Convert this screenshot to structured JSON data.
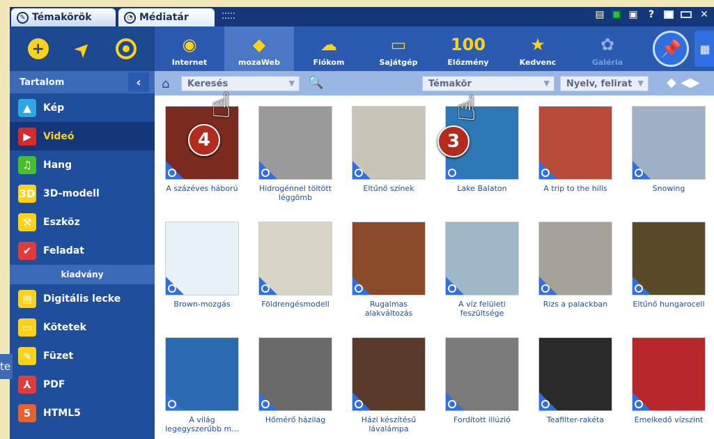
{
  "tabs": [
    {
      "label": "Témakörök",
      "icon": "topics-icon"
    },
    {
      "label": "Médiatár",
      "icon": "media-icon"
    }
  ],
  "window_controls": [
    "view-list-icon",
    "green-status-icon",
    "view-box-icon",
    "help-icon",
    "restore-icon",
    "minimize-icon",
    "close-icon"
  ],
  "help_glyph": "?",
  "close_glyph": "✕",
  "toolbar": [
    {
      "label": "Internet",
      "icon": "internet-icon"
    },
    {
      "label": "mozaWeb",
      "icon": "mozaweb-icon"
    },
    {
      "label": "Fiókom",
      "icon": "account-icon"
    },
    {
      "label": "Sajátgép",
      "icon": "computer-icon"
    },
    {
      "label": "Előzmény",
      "icon": "history-icon",
      "glyph": "100"
    },
    {
      "label": "Kedvenc",
      "icon": "favorite-icon"
    },
    {
      "label": "Galéria",
      "icon": "gallery-icon"
    }
  ],
  "sidebar": {
    "header": "Tartalom",
    "items": [
      {
        "label": "Kép",
        "icon": "image-icon",
        "glyph": "▲",
        "color": "#2fa8e0"
      },
      {
        "label": "Videó",
        "icon": "video-icon",
        "glyph": "▶",
        "color": "#d42a2a",
        "active": true
      },
      {
        "label": "Hang",
        "icon": "music-icon",
        "glyph": "♫",
        "color": "#47c12b"
      },
      {
        "label": "3D-modell",
        "icon": "3d-icon",
        "glyph": "3D",
        "color": "#ffd21a"
      },
      {
        "label": "Eszköz",
        "icon": "tool-icon",
        "glyph": "⚒",
        "color": "#ffd21a"
      },
      {
        "label": "Feladat",
        "icon": "task-icon",
        "glyph": "✔",
        "color": "#e23b3b"
      }
    ],
    "sub_header": "kiadvány",
    "pub_items": [
      {
        "label": "Digitális lecke",
        "icon": "digital-lesson-icon",
        "glyph": "▤",
        "color": "#ffd21a"
      },
      {
        "label": "Kötetek",
        "icon": "volumes-icon",
        "glyph": "▭",
        "color": "#ffd21a"
      },
      {
        "label": "Füzet",
        "icon": "notebook-icon",
        "glyph": "✎",
        "color": "#ffd21a"
      },
      {
        "label": "PDF",
        "icon": "pdf-icon",
        "glyph": "⅄",
        "color": "#e23b3b"
      },
      {
        "label": "HTML5",
        "icon": "html5-icon",
        "glyph": "5",
        "color": "#e8632b"
      }
    ],
    "side_tab": "te"
  },
  "search": {
    "placeholder": "Keresés",
    "topic": "Témakör",
    "language": "Nyelv, felirat"
  },
  "annotations": {
    "a": "4",
    "b": "3"
  },
  "videos": [
    {
      "title": "A százéves háború",
      "bg": "#7a2a1e"
    },
    {
      "title": "Hidrogénnel töltött léggömb",
      "bg": "#9a9a9a"
    },
    {
      "title": "Eltűnő színek",
      "bg": "#c9c4b8"
    },
    {
      "title": "Lake Balaton",
      "bg": "#2e78b8"
    },
    {
      "title": "A trip to the hills",
      "bg": "#b84a3a"
    },
    {
      "title": "Snowing",
      "bg": "#9fb0c4"
    },
    {
      "title": "Brown-mozgás",
      "bg": "#e6f2f8"
    },
    {
      "title": "Földrengésmodell",
      "bg": "#d8d4c6"
    },
    {
      "title": "Rugalmas alakváltozás",
      "bg": "#8a4a2a"
    },
    {
      "title": "A víz felületi feszültsége",
      "bg": "#9fb8c8"
    },
    {
      "title": "Rizs a palackban",
      "bg": "#a6a29a"
    },
    {
      "title": "Eltűnő hungarocell",
      "bg": "#5a4a2a"
    },
    {
      "title": "A világ legegyszerűbb m...",
      "bg": "#2a6ab0"
    },
    {
      "title": "Hőmérő házilag",
      "bg": "#6a6a6a"
    },
    {
      "title": "Házi készítésű lávalámpa",
      "bg": "#5a3a2a"
    },
    {
      "title": "Fordított illúzió",
      "bg": "#7a7a7a"
    },
    {
      "title": "Teafilter-rakéta",
      "bg": "#2a2a2a"
    },
    {
      "title": "Emelkedő vízszint",
      "bg": "#b8282a"
    }
  ]
}
